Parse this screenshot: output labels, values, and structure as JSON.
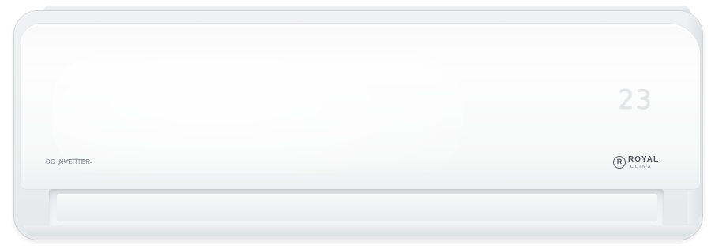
{
  "product": {
    "display": {
      "temperature": "23"
    },
    "labels": {
      "inverter": "DC INVERTER",
      "brand": "ROYAL",
      "brand_sub": "CLIMA",
      "brand_mark": "R"
    },
    "colors": {
      "body": "#f7f8f8",
      "display_digits": "#e3e5e7",
      "logo_text": "#55595e"
    },
    "icons": [
      "inverter-swoosh-icon",
      "royal-clima-logo-icon"
    ]
  }
}
